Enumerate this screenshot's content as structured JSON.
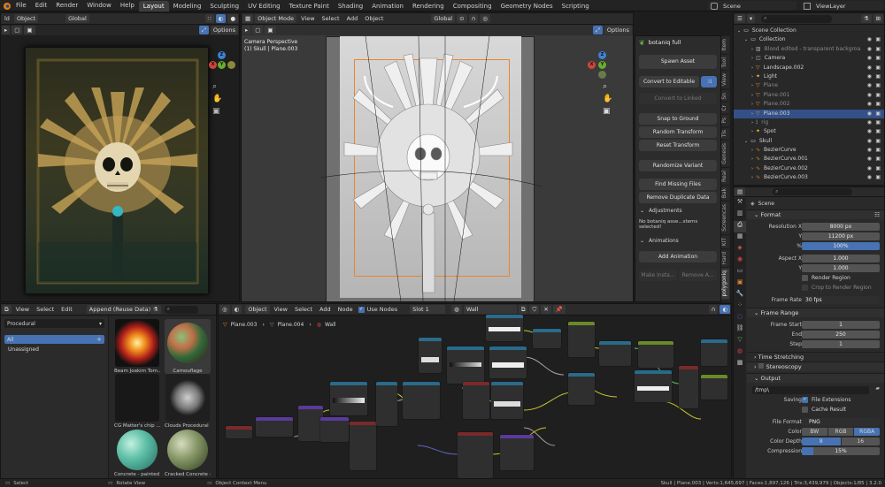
{
  "topbar": {
    "menus": [
      "File",
      "Edit",
      "Render",
      "Window",
      "Help"
    ],
    "workspaces": [
      "Layout",
      "Modeling",
      "Sculpting",
      "UV Editing",
      "Texture Paint",
      "Shading",
      "Animation",
      "Rendering",
      "Compositing",
      "Geometry Nodes",
      "Scripting"
    ],
    "active_workspace": "Layout",
    "scene": "Scene",
    "view_layer": "ViewLayer"
  },
  "left_view": {
    "header": [
      "ld",
      "Object",
      "Global"
    ],
    "options": "Options"
  },
  "main_view": {
    "mode": "Object Mode",
    "menus": [
      "View",
      "Select",
      "Add",
      "Object"
    ],
    "orientation": "Global",
    "options": "Options",
    "camera_text": "Camera Perspective",
    "object_text": "(1) Skull | Plane.003"
  },
  "npanel": {
    "title": "botaniq full",
    "buttons": [
      "Spawn Asset",
      "Convert to Editable",
      "Convert to Linked",
      "Snap to Ground",
      "Random Transform",
      "Reset Transform",
      "Randomize Variant",
      "Find Missing Files",
      "Remove Duplicate Data"
    ],
    "adjustments": "Adjustments",
    "adjust_msg": "No botaniq asse...stems selected!",
    "animations": "Animations",
    "add_animation": "Add Animation",
    "make_instance": "Make Insta...",
    "remove_a": "Remove A...",
    "tabs": [
      "Item",
      "Tool",
      "View",
      "Sn",
      "Cr",
      "Ps",
      "Tls",
      "Genesis",
      "Real",
      "Bak",
      "Screencas",
      "KIT",
      "Hard",
      "polygoniq"
    ]
  },
  "outliner": {
    "search_placeholder": "",
    "rows": [
      {
        "label": "Scene Collection",
        "indent": 0,
        "icon": "collection-icon"
      },
      {
        "label": "Collection",
        "indent": 1,
        "icon": "collection-icon"
      },
      {
        "label": "Blood edited - transparent backgroa",
        "indent": 2,
        "icon": "image-icon",
        "dim": true
      },
      {
        "label": "Camera",
        "indent": 2,
        "icon": "camera-icon"
      },
      {
        "label": "Landscape.002",
        "indent": 2,
        "icon": "mesh-icon"
      },
      {
        "label": "Light",
        "indent": 2,
        "icon": "light-icon"
      },
      {
        "label": "Plane",
        "indent": 2,
        "icon": "mesh-icon",
        "dim": true
      },
      {
        "label": "Plane.001",
        "indent": 2,
        "icon": "mesh-icon",
        "dim": true
      },
      {
        "label": "Plane.002",
        "indent": 2,
        "icon": "mesh-icon",
        "dim": true
      },
      {
        "label": "Plane.003",
        "indent": 2,
        "icon": "mesh-icon",
        "selected": true
      },
      {
        "label": "rig",
        "indent": 2,
        "icon": "armature-icon",
        "dim": true
      },
      {
        "label": "Spot",
        "indent": 2,
        "icon": "light-icon"
      },
      {
        "label": "Skull",
        "indent": 1,
        "icon": "collection-icon"
      },
      {
        "label": "BezierCurve",
        "indent": 2,
        "icon": "curve-icon"
      },
      {
        "label": "BezierCurve.001",
        "indent": 2,
        "icon": "curve-icon"
      },
      {
        "label": "BezierCurve.002",
        "indent": 2,
        "icon": "curve-icon"
      },
      {
        "label": "BezierCurve.003",
        "indent": 2,
        "icon": "curve-icon"
      }
    ]
  },
  "properties": {
    "scene_label": "Scene",
    "format_section": "Format",
    "res_x_label": "Resolution X",
    "res_x": "8000 px",
    "res_y_label": "Y",
    "res_y": "11200 px",
    "res_pct_label": "%",
    "res_pct": "100%",
    "aspect_x_label": "Aspect X",
    "aspect_x": "1.000",
    "aspect_y_label": "Y",
    "aspect_y": "1.000",
    "render_region": "Render Region",
    "crop_region": "Crop to Render Region",
    "frame_rate_label": "Frame Rate",
    "frame_rate": "30 fps",
    "frame_range_section": "Frame Range",
    "frame_start_label": "Frame Start",
    "frame_start": "1",
    "end_label": "End",
    "end": "250",
    "step_label": "Step",
    "step": "1",
    "time_stretching": "Time Stretching",
    "stereoscopy": "Stereoscopy",
    "output_section": "Output",
    "output_path": "/tmp\\",
    "saving_label": "Saving",
    "file_extensions": "File Extensions",
    "cache_result": "Cache Result",
    "file_format_label": "File Format",
    "file_format": "PNG",
    "color_label": "Color",
    "color_opts": [
      "BW",
      "RGB",
      "RGBA"
    ],
    "depth_label": "Color Depth",
    "depth_opts": [
      "8",
      "16"
    ],
    "compression_label": "Compression",
    "compression": "15%",
    "compression_value": 0.15
  },
  "asset_browser": {
    "menus": [
      "View",
      "Select",
      "Edit"
    ],
    "import_mode": "Append (Reuse Data)",
    "library": "Procedural",
    "catalog_all": "All",
    "catalog_unassigned": "Unassigned",
    "assets": [
      {
        "label": "Beam Joakim Tom...",
        "swatch": "fire"
      },
      {
        "label": "Camouflage",
        "swatch": "camo"
      },
      {
        "label": "CG Matter's chip ...",
        "swatch": "dark"
      },
      {
        "label": "Clouds Procedural ...",
        "swatch": "cloud"
      },
      {
        "label": "Concrete - painted ...",
        "swatch": "teal"
      },
      {
        "label": "Cracked Concrete - ...",
        "swatch": "green"
      }
    ]
  },
  "node_editor": {
    "mode": "Object",
    "menus": [
      "View",
      "Select",
      "Add",
      "Node"
    ],
    "use_nodes": "Use Nodes",
    "slot": "Slot 1",
    "material": "Wall",
    "breadcrumb": [
      "Plane.003",
      "Plane.004",
      "Wall"
    ]
  },
  "statusbar": {
    "select": "Select",
    "rotate": "Rotate View",
    "context": "Object Context Menu",
    "stats": "Skull | Plane.003 | Verts:1,645,697 | Faces:1,897,126 | Tris:3,439,979 | Objects:1/85 | 3.2.0"
  },
  "colors": {
    "accent": "#4772b3",
    "selected_row": "#335088",
    "orange_outline": "#e8862a"
  }
}
